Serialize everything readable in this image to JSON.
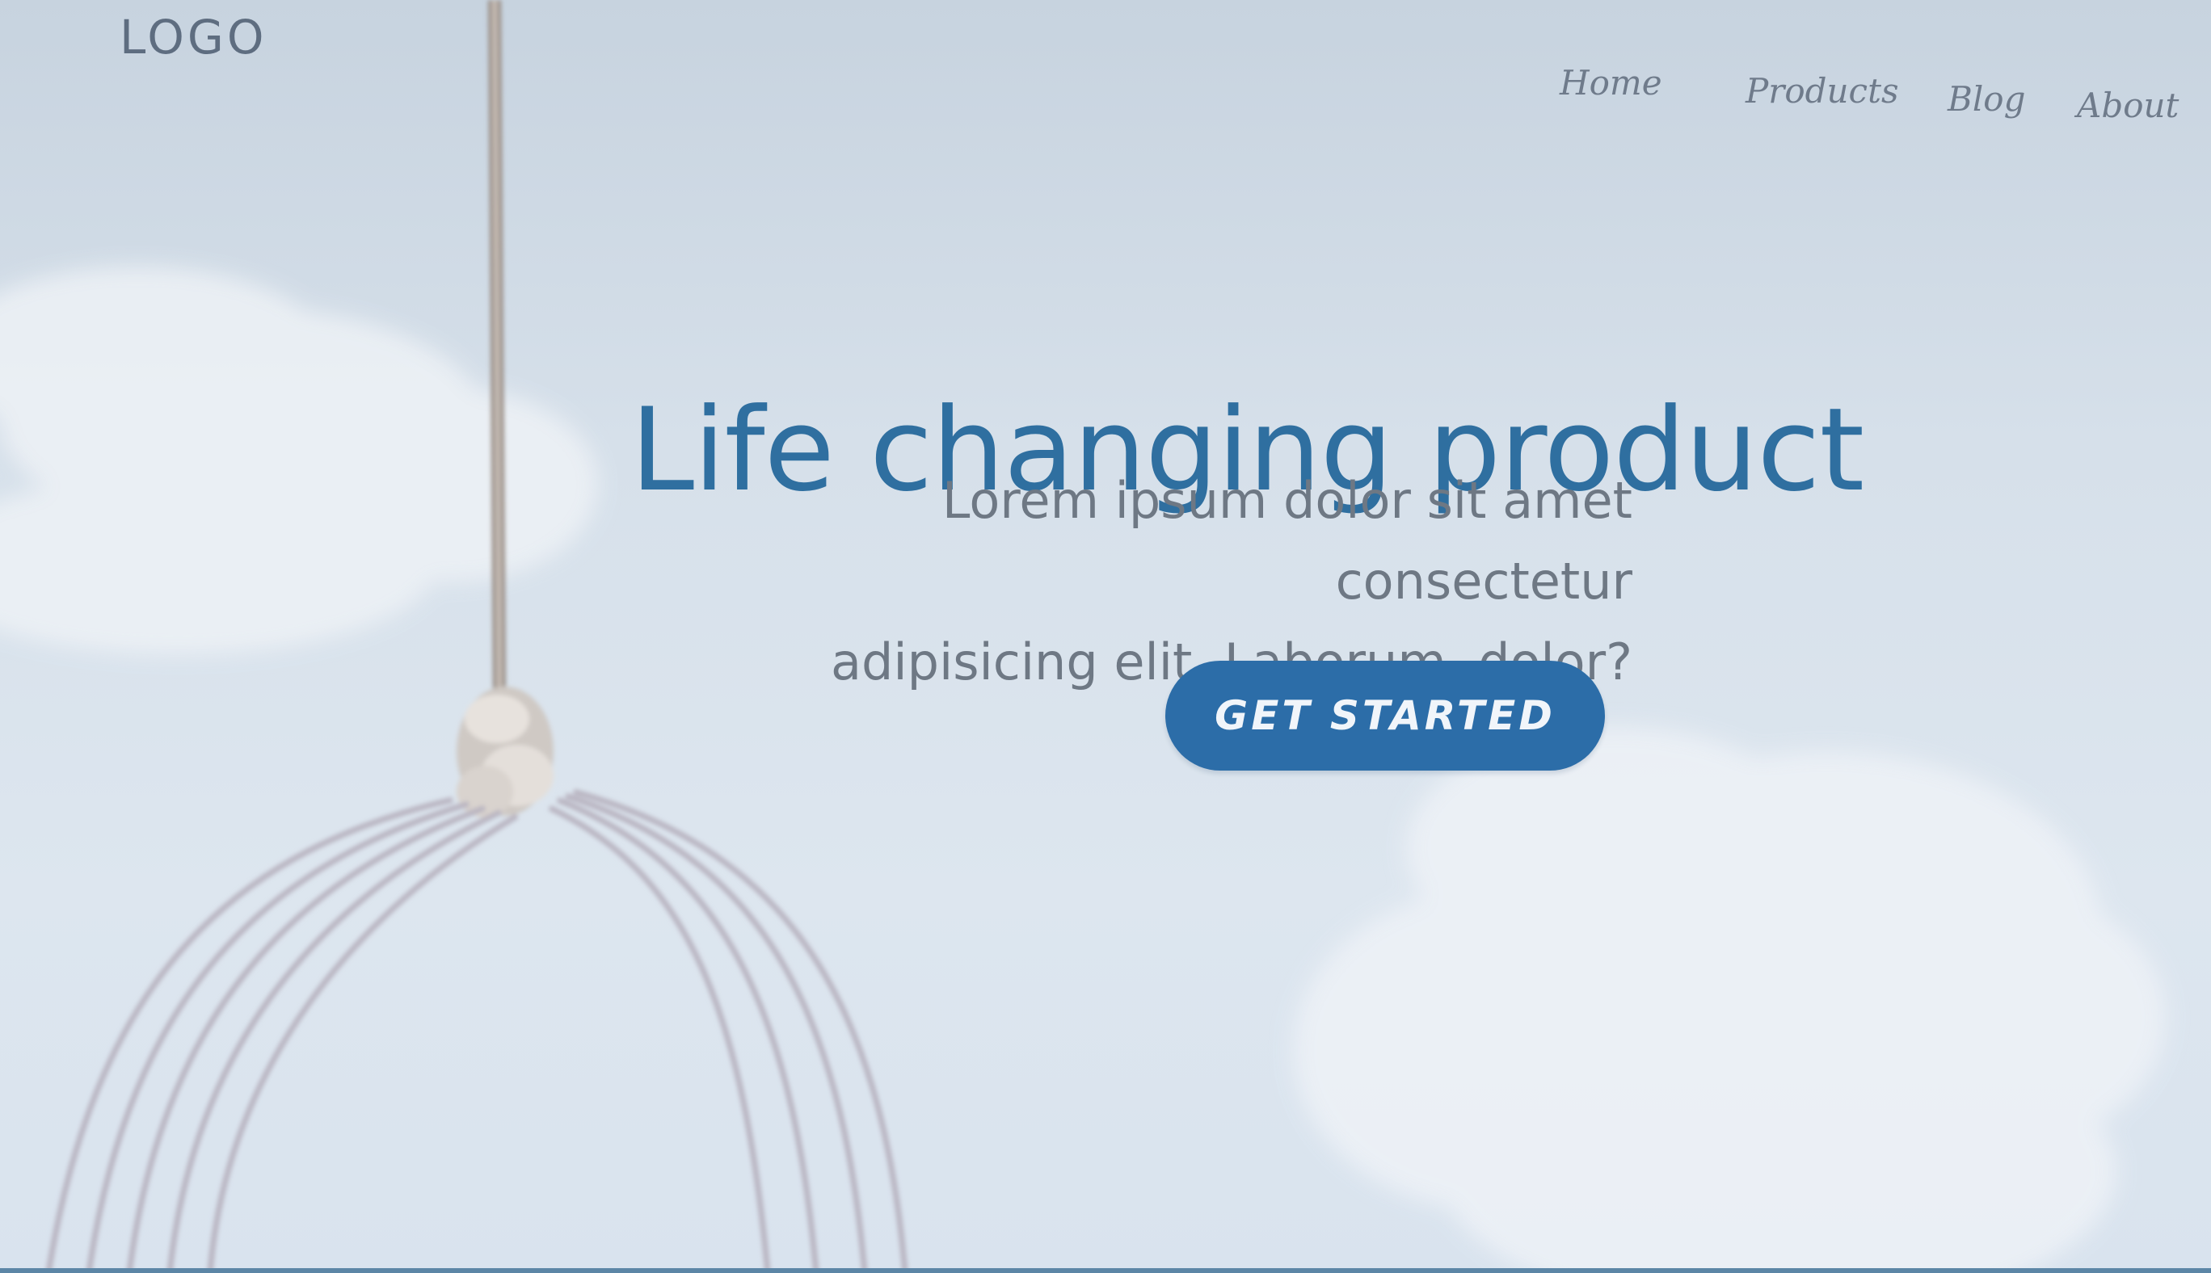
{
  "header": {
    "logo_text": "LOGO",
    "nav": [
      {
        "label": "Home"
      },
      {
        "label": "Products"
      },
      {
        "label": "Blog"
      },
      {
        "label": "About"
      }
    ]
  },
  "hero": {
    "title": "Life changing product",
    "subtitle_line1": "Lorem ipsum dolor sit amet consectetur",
    "subtitle_line2": "adipisicing elit. Laborum, dolor?",
    "cta_label": "GET STARTED"
  },
  "colors": {
    "accent": "#2c6da8",
    "title": "#2f6fa0",
    "background": "#d6e0ea"
  },
  "images": {
    "background": "sky-with-clouds-and-rope-swing-illustration"
  }
}
